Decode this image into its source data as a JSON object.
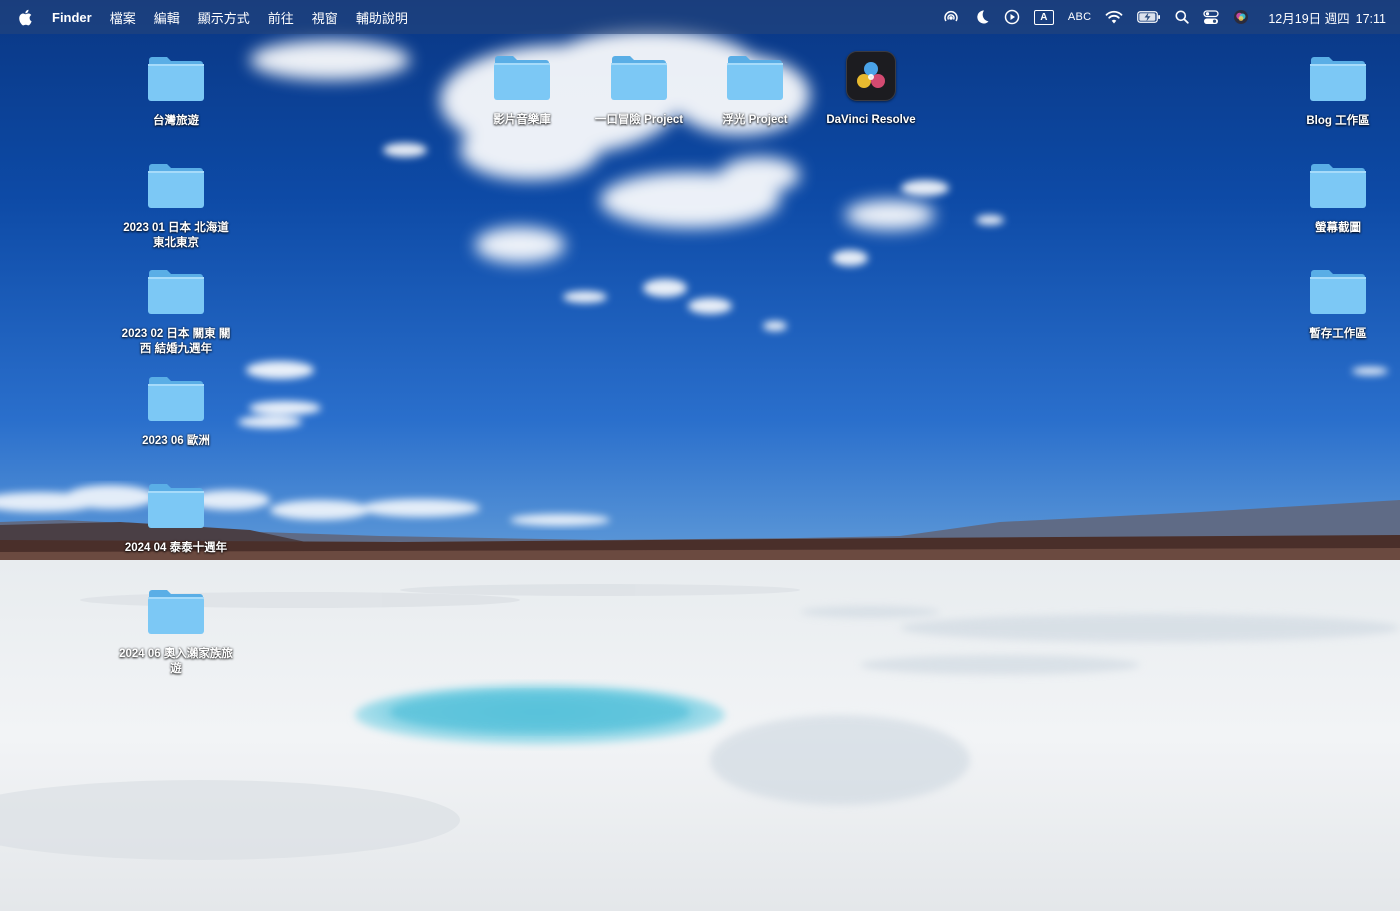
{
  "menubar": {
    "apple_icon": "apple-logo-icon",
    "app_name": "Finder",
    "menus": [
      "檔案",
      "編輯",
      "顯示方式",
      "前往",
      "視窗",
      "輔助說明"
    ],
    "status": {
      "input_mode_badge": "A",
      "input_source": "ABC",
      "date": "12月19日 週四",
      "time": "17:11"
    }
  },
  "desktop": {
    "left_column": [
      {
        "label": "台灣旅遊"
      },
      {
        "label": "2023 01 日本 北海道 東北東京"
      },
      {
        "label": "2023 02 日本 關東 關西 結婚九週年"
      },
      {
        "label": "2023 06 歐洲"
      },
      {
        "label": "2024 04 泰泰十週年"
      },
      {
        "label": "2024 06 奧入瀨家族旅遊"
      }
    ],
    "top_row": [
      {
        "label": "影片音樂庫"
      },
      {
        "label": "一口冒險 Project"
      },
      {
        "label": "浮光 Project"
      },
      {
        "label": "DaVinci Resolve",
        "type": "app"
      }
    ],
    "right_column": [
      {
        "label": "Blog 工作區"
      },
      {
        "label": "螢幕截圖"
      },
      {
        "label": "暫存工作區"
      }
    ]
  },
  "colors": {
    "folder_front": "#7cc8f5",
    "folder_back": "#5aaee6",
    "sky_top": "#0b3f8f",
    "sky_horizon": "#3e86d6",
    "salt_flat": "#eef1f4",
    "pool": "#7fd0e4"
  }
}
